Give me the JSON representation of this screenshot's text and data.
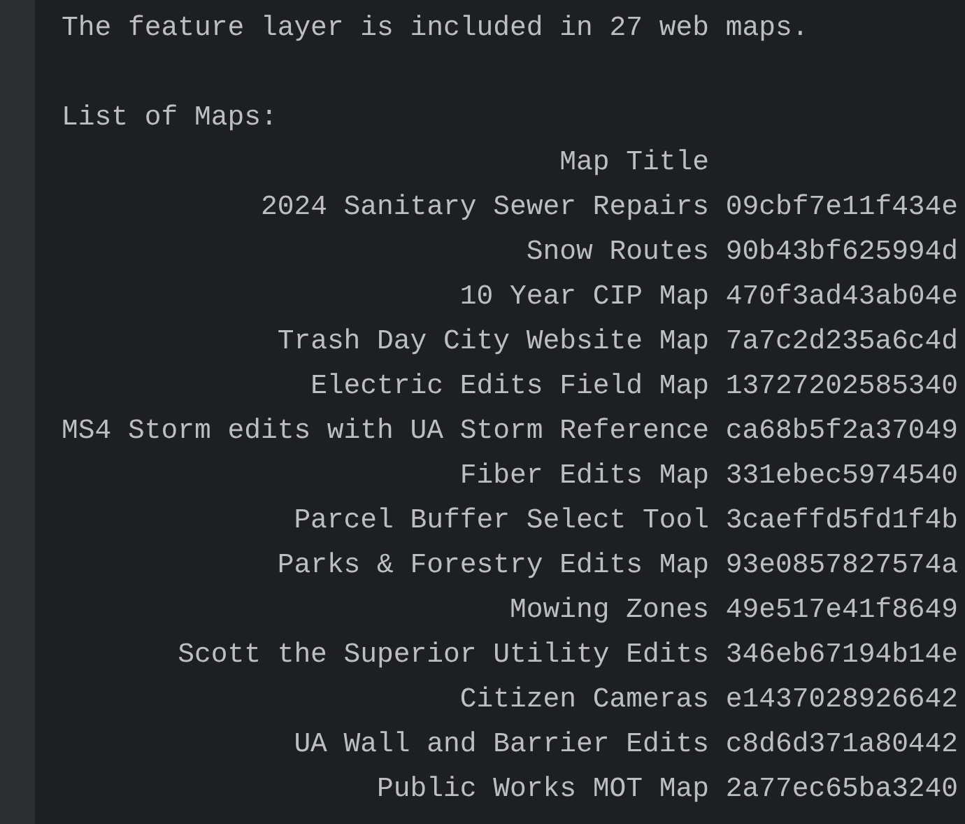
{
  "output": {
    "summary": "The feature layer is included in 27 web maps.",
    "list_heading": "List of Maps:"
  },
  "table": {
    "columns": [
      "Map Title"
    ],
    "rows": [
      {
        "title": "2024 Sanitary Sewer Repairs",
        "column_2": "09cbf7e11f434e"
      },
      {
        "title": "Snow Routes",
        "column_2": "90b43bf625994d"
      },
      {
        "title": "10 Year CIP Map",
        "column_2": "470f3ad43ab04e"
      },
      {
        "title": "Trash Day City Website Map",
        "column_2": "7a7c2d235a6c4d"
      },
      {
        "title": "Electric Edits Field Map",
        "column_2": "13727202585340"
      },
      {
        "title": "MS4 Storm edits with UA Storm Reference",
        "column_2": "ca68b5f2a37049"
      },
      {
        "title": "Fiber Edits Map",
        "column_2": "331ebec5974540"
      },
      {
        "title": "Parcel Buffer Select Tool",
        "column_2": "3caeffd5fd1f4b"
      },
      {
        "title": "Parks & Forestry Edits Map",
        "column_2": "93e0857827574a"
      },
      {
        "title": "Mowing Zones",
        "column_2": "49e517e41f8649"
      },
      {
        "title": "Scott the Superior Utility Edits",
        "column_2": "346eb67194b14e"
      },
      {
        "title": "Citizen Cameras",
        "column_2": "e1437028926642"
      },
      {
        "title": "UA Wall and Barrier Edits",
        "column_2": "c8d6d371a80442"
      },
      {
        "title": "Public Works MOT Map",
        "column_2": "2a77ec65ba3240"
      }
    ]
  }
}
